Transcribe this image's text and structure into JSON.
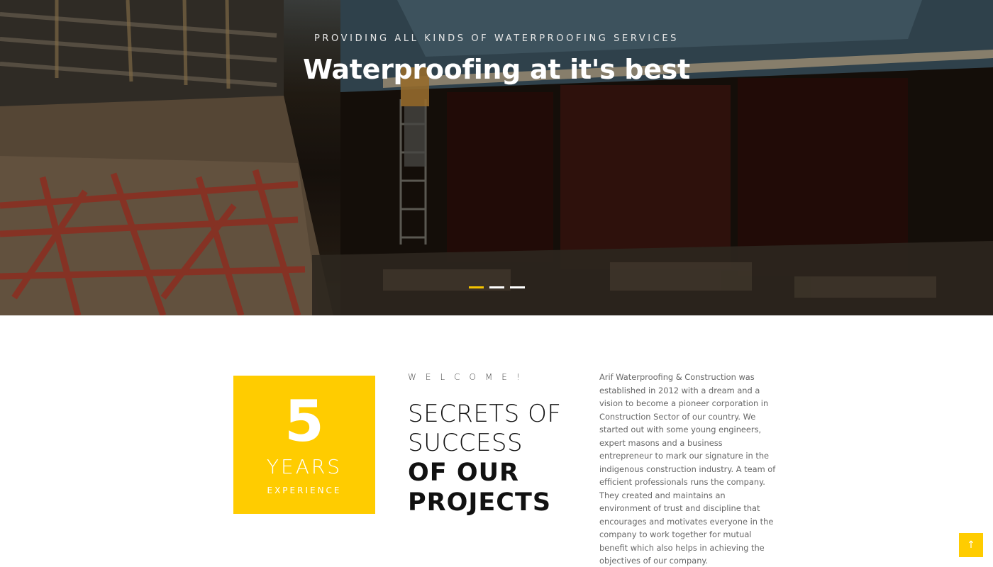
{
  "hero": {
    "kicker": "PROVIDING ALL KINDS OF WATERPROOFING SERVICES",
    "title": "Waterproofing at it's best",
    "slides": [
      {
        "active": true
      },
      {
        "active": false
      },
      {
        "active": false
      }
    ],
    "accent_color": "#f5c400"
  },
  "experience": {
    "number": "5",
    "label": "YEARS",
    "sublabel": "EXPERIENCE",
    "box_color": "#ffcc00"
  },
  "welcome": {
    "kicker": "WELCOME!",
    "headline_light_1": "SECRETS OF",
    "headline_light_2": "SUCCESS",
    "headline_bold_1": "OF OUR",
    "headline_bold_2": "PROJECTS",
    "about": "Arif Waterproofing & Construction was established in 2012 with a dream and a vision to become a pioneer corporation in Construction Sector of our country. We started out with some young engineers, expert masons and a business entrepreneur to mark our signature in the indigenous construction industry. A team of efficient professionals runs the company. They created and maintains an environment of trust and discipline that encourages and motivates everyone in the company to work together for mutual benefit which also helps in achieving the objectives of our company."
  },
  "scroll_top": {
    "icon": "arrow-up-icon",
    "glyph": "↑"
  }
}
